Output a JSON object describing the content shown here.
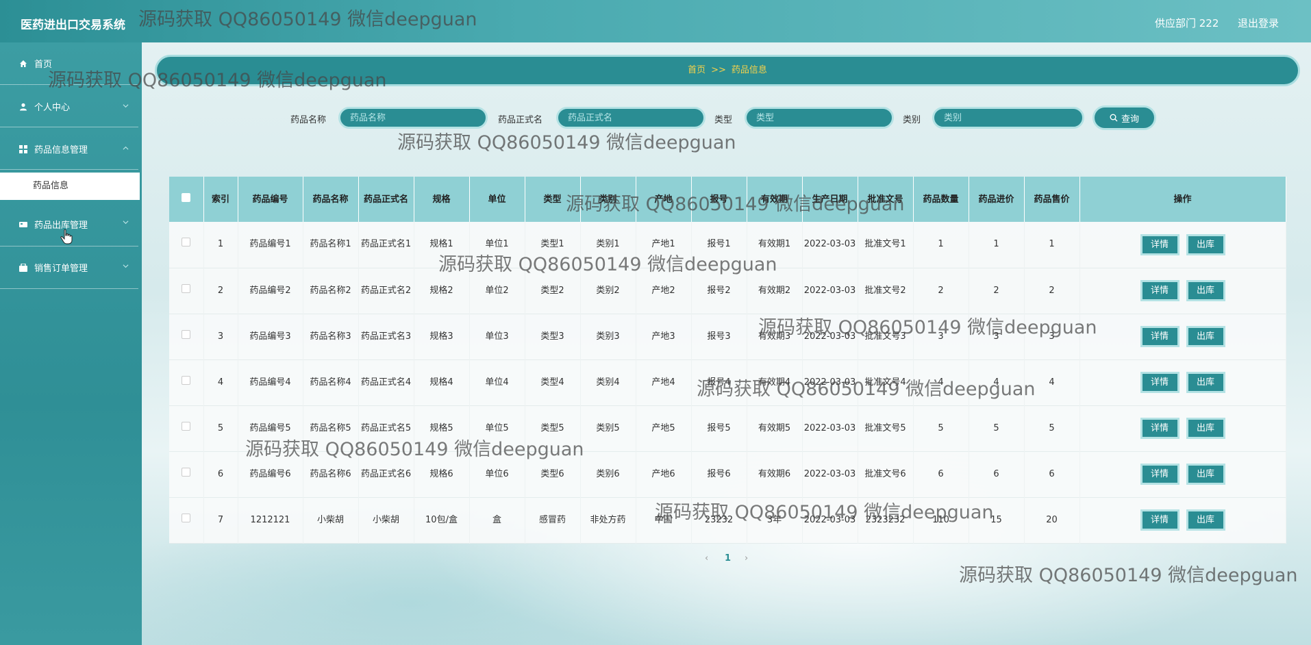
{
  "header": {
    "title": "医药进出口交易系统",
    "user": "供应部门 222",
    "logout": "退出登录"
  },
  "sidebar": {
    "items": [
      {
        "label": "首页"
      },
      {
        "label": "个人中心"
      },
      {
        "label": "药品信息管理"
      },
      {
        "label": "药品出库管理"
      },
      {
        "label": "销售订单管理"
      }
    ],
    "sub_item": "药品信息"
  },
  "breadcrumb": {
    "home": "首页",
    "sep": ">>",
    "current": "药品信息"
  },
  "search": {
    "fields": [
      {
        "label": "药品名称",
        "placeholder": "药品名称"
      },
      {
        "label": "药品正式名",
        "placeholder": "药品正式名"
      },
      {
        "label": "类型",
        "placeholder": "类型"
      },
      {
        "label": "类别",
        "placeholder": "类别"
      }
    ],
    "button": "查询"
  },
  "table": {
    "columns": [
      "索引",
      "药品编号",
      "药品名称",
      "药品正式名",
      "规格",
      "单位",
      "类型",
      "类别",
      "产地",
      "报号",
      "有效期",
      "生产日期",
      "批准文号",
      "药品数量",
      "药品进价",
      "药品售价",
      "操作"
    ],
    "rows": [
      [
        "1",
        "药品编号1",
        "药品名称1",
        "药品正式名1",
        "规格1",
        "单位1",
        "类型1",
        "类别1",
        "产地1",
        "报号1",
        "有效期1",
        "2022-03-03",
        "批准文号1",
        "1",
        "1",
        "1"
      ],
      [
        "2",
        "药品编号2",
        "药品名称2",
        "药品正式名2",
        "规格2",
        "单位2",
        "类型2",
        "类别2",
        "产地2",
        "报号2",
        "有效期2",
        "2022-03-03",
        "批准文号2",
        "2",
        "2",
        "2"
      ],
      [
        "3",
        "药品编号3",
        "药品名称3",
        "药品正式名3",
        "规格3",
        "单位3",
        "类型3",
        "类别3",
        "产地3",
        "报号3",
        "有效期3",
        "2022-03-03",
        "批准文号3",
        "3",
        "3",
        "3"
      ],
      [
        "4",
        "药品编号4",
        "药品名称4",
        "药品正式名4",
        "规格4",
        "单位4",
        "类型4",
        "类别4",
        "产地4",
        "报号4",
        "有效期4",
        "2022-03-03",
        "批准文号4",
        "4",
        "4",
        "4"
      ],
      [
        "5",
        "药品编号5",
        "药品名称5",
        "药品正式名5",
        "规格5",
        "单位5",
        "类型5",
        "类别5",
        "产地5",
        "报号5",
        "有效期5",
        "2022-03-03",
        "批准文号5",
        "5",
        "5",
        "5"
      ],
      [
        "6",
        "药品编号6",
        "药品名称6",
        "药品正式名6",
        "规格6",
        "单位6",
        "类型6",
        "类别6",
        "产地6",
        "报号6",
        "有效期6",
        "2022-03-03",
        "批准文号6",
        "6",
        "6",
        "6"
      ],
      [
        "7",
        "1212121",
        "小柴胡",
        "小柴胡",
        "10包/盒",
        "盒",
        "感冒药",
        "非处方药",
        "中国",
        "23232",
        "3年",
        "2022-03-03",
        "2323232",
        "110",
        "15",
        "20"
      ]
    ],
    "actions": [
      "详情",
      "出库"
    ]
  },
  "pagination": {
    "prev": "‹",
    "current": "1",
    "next": "›"
  },
  "watermark": "源码获取 QQ86050149 微信deepguan",
  "colors": {
    "primary": "#2a8d93",
    "accent": "#f5d24b",
    "header_row": "#8fd0d4"
  }
}
